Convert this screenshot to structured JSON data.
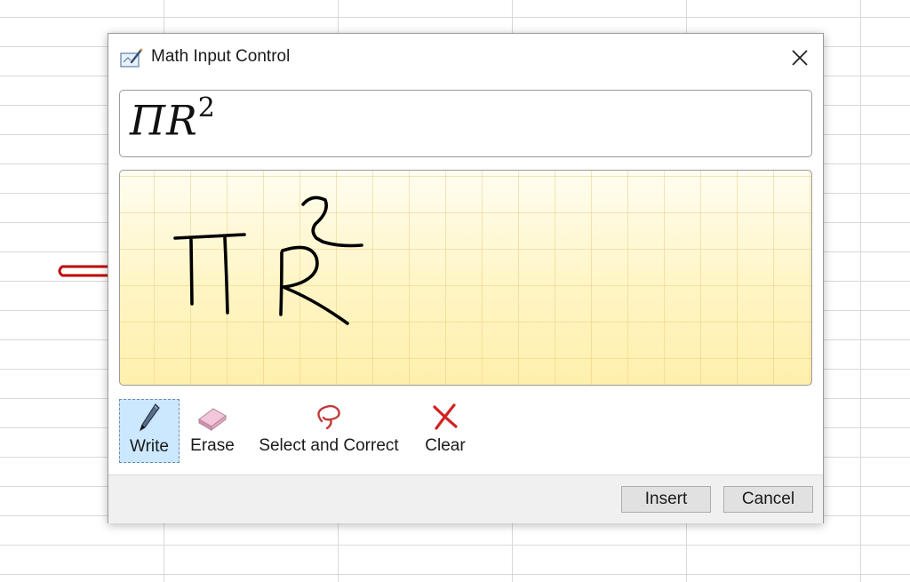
{
  "window": {
    "title": "Math Input Control",
    "app_icon": "math-input-icon",
    "close_icon": "close-icon"
  },
  "preview": {
    "symbol": "ΠR",
    "exponent": "2"
  },
  "tools": [
    {
      "label": "Write",
      "icon": "pen-icon",
      "selected": true
    },
    {
      "label": "Erase",
      "icon": "eraser-icon",
      "selected": false
    },
    {
      "label": "Select and Correct",
      "icon": "lasso-icon",
      "selected": false
    },
    {
      "label": "Clear",
      "icon": "clear-x-icon",
      "selected": false
    }
  ],
  "buttons": {
    "insert": "Insert",
    "cancel": "Cancel"
  },
  "colors": {
    "accent_arrow": "#c00000",
    "pad_yellow": "#fff3b8",
    "selected_tool": "#cce8ff"
  }
}
